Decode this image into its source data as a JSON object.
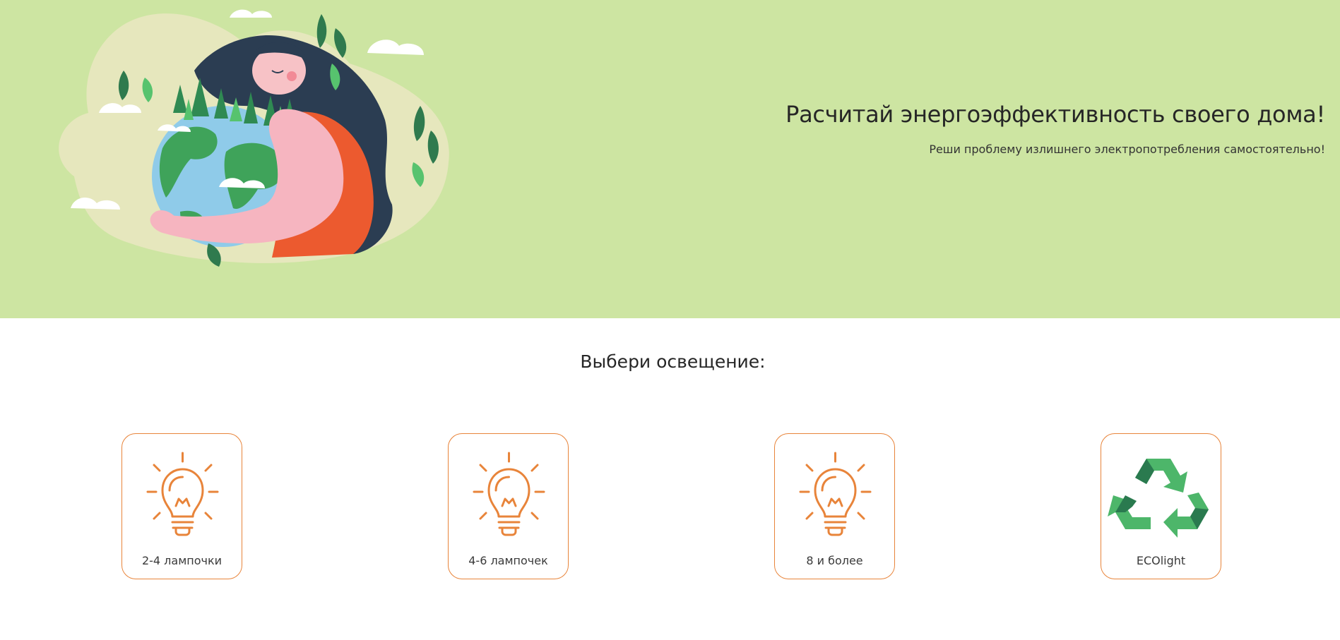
{
  "hero": {
    "title": "Расчитай энергоэффективность своего дома!",
    "subtitle": "Реши проблему излишнего электропотребления самостоятельно!",
    "illustration_icon": "woman-hugging-earth-illustration"
  },
  "lighting": {
    "title": "Выбери освещение:",
    "options": [
      {
        "label": "2-4 лампочки",
        "icon": "lightbulb-icon"
      },
      {
        "label": "4-6 лампочек",
        "icon": "lightbulb-icon"
      },
      {
        "label": "8 и более",
        "icon": "lightbulb-icon"
      },
      {
        "label": "ECOlight",
        "icon": "recycle-icon"
      }
    ]
  },
  "colors": {
    "hero_background": "#cde5a2",
    "accent": "#e8843a",
    "recycle_green_light": "#4db66a",
    "recycle_green_dark": "#2a7a4f"
  }
}
